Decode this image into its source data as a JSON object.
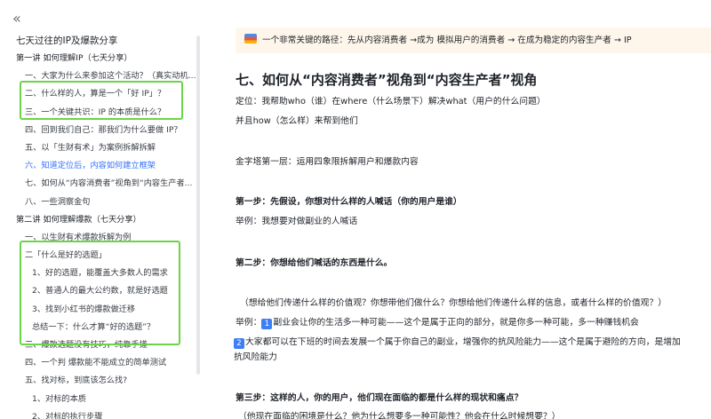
{
  "sidebar": {
    "collapse_glyph": "«",
    "doc_title": "七天过往的IP及爆款分享",
    "items": [
      {
        "label": "第一讲 如何理解IP（七天分享）",
        "level": 1
      },
      {
        "label": "一、大家为什么来参加这个活动？（真实动机...",
        "level": 2
      },
      {
        "label": "二、什么样的人，算是一个「好 IP」？",
        "level": 2
      },
      {
        "label": "三、一个关键共识：IP 的本质是什么？",
        "level": 2
      },
      {
        "label": "四、回到我们自己：那我们为什么要做 IP？",
        "level": 2
      },
      {
        "label": "五、以「生财有术」为案例拆解拆解",
        "level": 2
      },
      {
        "label": "六、知道定位后，内容如何建立框架",
        "level": 2,
        "active": true
      },
      {
        "label": "七、如何从“内容消费者”视角到“内容生产者...",
        "level": 2
      },
      {
        "label": "八、一些洞察金句",
        "level": 2
      },
      {
        "label": "第二讲 如何理解爆款（七天分享）",
        "level": 1
      },
      {
        "label": "一、以生财有术爆款拆解为例",
        "level": 2
      },
      {
        "label": "二「什么是好的选题」",
        "level": 2
      },
      {
        "label": "1、好的选题，能覆盖大多数人的需求",
        "level": 3
      },
      {
        "label": "2、普通人的最大公约数，就是好选题",
        "level": 3
      },
      {
        "label": "3、找到小红书的爆款做迁移",
        "level": 3
      },
      {
        "label": "总结一下：什么才算“好的选题”？",
        "level": 4
      },
      {
        "label": "三、爆款选题没有技巧，纯靠手搓",
        "level": 2
      },
      {
        "label": "四、一个判 爆款能不能成立的简单测试",
        "level": 2
      },
      {
        "label": "五、找对标，到底该怎么找?",
        "level": 2
      },
      {
        "label": "1、对标的本质",
        "level": 3
      },
      {
        "label": "2、对标的执行步骤",
        "level": 3
      }
    ]
  },
  "main": {
    "callout_text": "一个非常关键的路径：先从内容消费者 →成为 模拟用户的消费者 → 在成为稳定的内容生产者 → IP",
    "heading": "七、如何从“内容消费者”视角到“内容生产者”视角",
    "positioning_line": "定位：我帮助who（谁）在where（什么场景下）解决what（用户的什么问题）",
    "how_line": "并且how（怎么样）来帮到他们",
    "pyramid_line": "金字塔第一层：运用四象限拆解用户和爆款内容",
    "step1_title": "第一步：先假设，你想对什么样的人喊话（你的用户是谁）",
    "step1_example": "举例：我想要对做副业的人喊话",
    "step2_title": "第二步：你想给他们喊话的东西是什么。",
    "step2_question": "（想给他们传递什么样的价值观？你想带他们做什么？你想给他们传递什么样的信息，或者什么样的价值观？）",
    "step2_ex_prefix": "举例：",
    "badge_1": "1",
    "step2_ex_1": "副业会让你的生活多一种可能——这个是属于正向的部分，就是你多一种可能，多一种赚钱机会",
    "badge_2": "2",
    "step2_ex_2": "大家都可以在下班的时间去发展一个属于你自己的副业，增强你的抗风险能力——这个是属于避险的方向，是增加",
    "step2_ex_2b": "抗风险能力",
    "step3_title": "第三步：这样的人，你的用户，他们现在面临的都是什么样的现状和痛点？",
    "step3_question": "（他现在面临的困境是什么？他为什么想要多一种可能性？他会在什么时候想要？）"
  }
}
